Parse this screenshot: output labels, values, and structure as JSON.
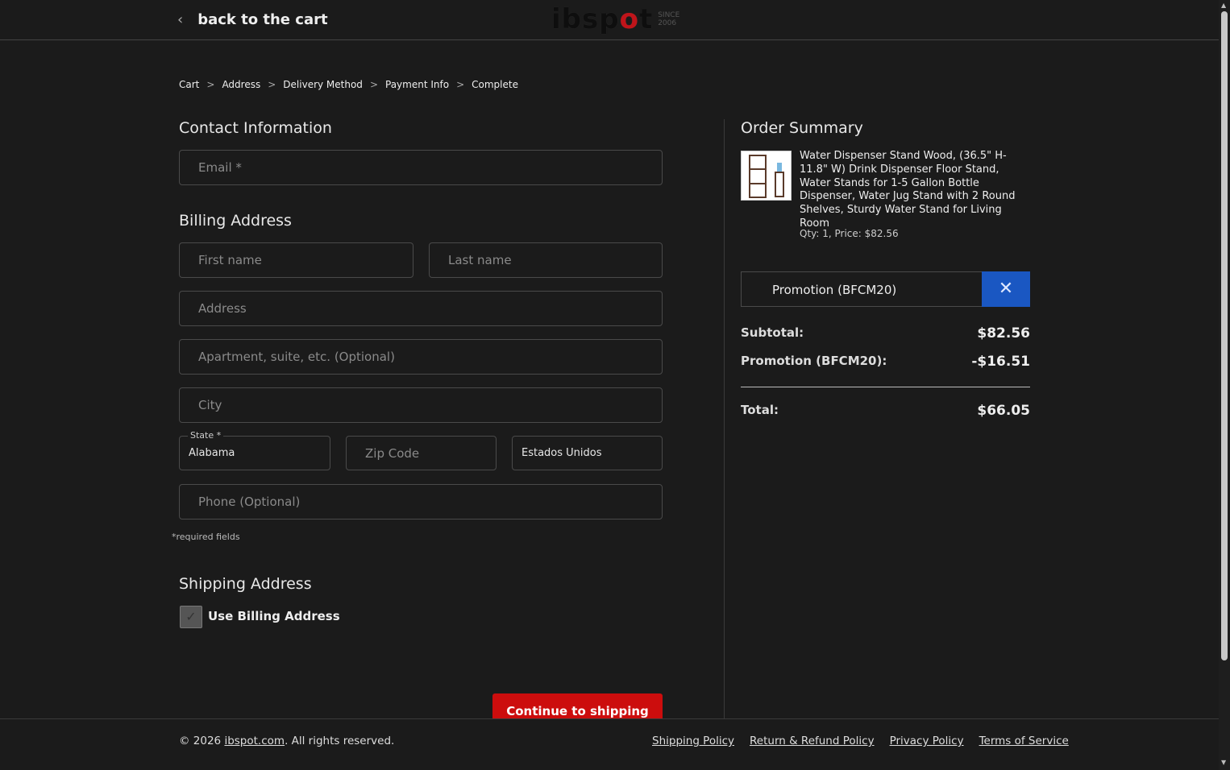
{
  "header": {
    "back_label": "back to the cart",
    "logo_text": "ibspot",
    "logo_since": "SINCE 2006"
  },
  "breadcrumb": [
    "Cart",
    "Address",
    "Delivery Method",
    "Payment Info",
    "Complete"
  ],
  "breadcrumb_sep": ">",
  "contact": {
    "title": "Contact Information",
    "email_placeholder": "Email *"
  },
  "billing": {
    "title": "Billing Address",
    "first_name": "First name",
    "last_name": "Last name",
    "address": "Address",
    "apartment": "Apartment, suite, etc. (Optional)",
    "city": "City",
    "state_label": "State *",
    "state_value": "Alabama",
    "zip": "Zip Code",
    "country": "Estados Unidos",
    "phone": "Phone (Optional)",
    "required_note": "*required fields"
  },
  "shipping": {
    "title": "Shipping Address",
    "use_billing_label": "Use Billing Address",
    "use_billing_checked": true
  },
  "continue_label": "Continue to shipping",
  "summary": {
    "title": "Order Summary",
    "product_title": "Water Dispenser Stand Wood, (36.5\" H-11.8\" W) Drink Dispenser Floor Stand, Water Stands for 1-5 Gallon Bottle Dispenser, Water Jug Stand with 2 Round Shelves, Sturdy Water Stand for Living Room",
    "qty_price": "Qty: 1, Price: $82.56",
    "promo_code": "Promotion (BFCM20)",
    "subtotal_label": "Subtotal:",
    "subtotal": "$82.56",
    "promo_label": "Promotion (BFCM20):",
    "promo_value": "-$16.51",
    "total_label": "Total:",
    "total": "$66.05"
  },
  "footer": {
    "copyright_prefix": "© 2026 ",
    "site_link": "ibspot.com",
    "copyright_suffix": ". All rights reserved.",
    "links": [
      "Shipping Policy",
      "Return & Refund Policy",
      "Privacy Policy",
      "Terms of Service"
    ]
  },
  "colors": {
    "accent_red": "#cc0d0d",
    "accent_blue": "#1a57c2",
    "background": "#1b1b1b"
  }
}
